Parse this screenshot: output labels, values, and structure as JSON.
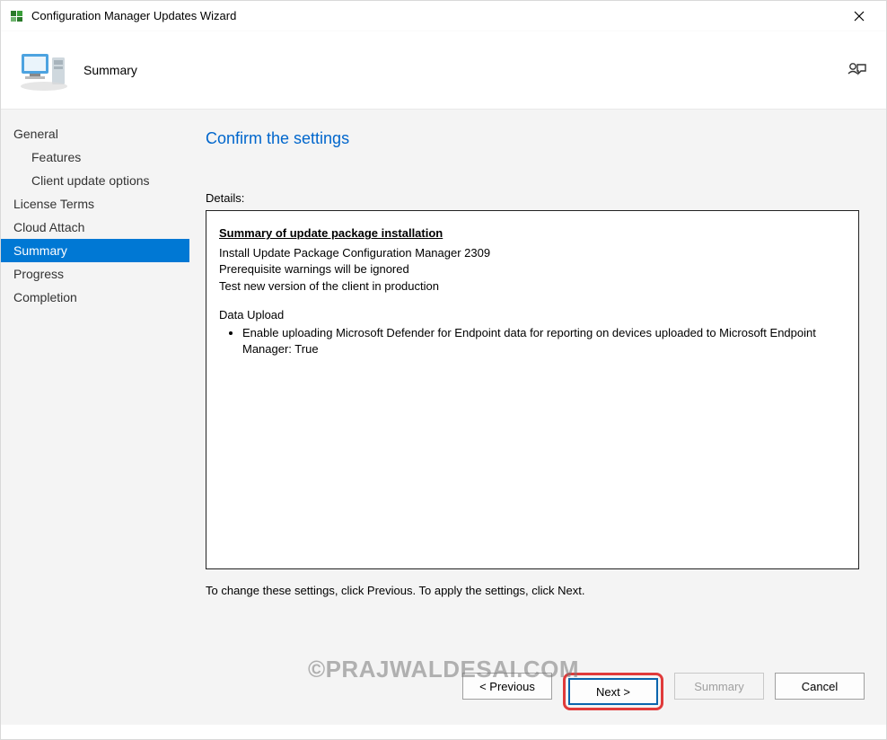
{
  "window": {
    "title": "Configuration Manager Updates Wizard"
  },
  "header": {
    "title": "Summary"
  },
  "sidebar": {
    "items": [
      {
        "label": "General",
        "sub": false,
        "selected": false
      },
      {
        "label": "Features",
        "sub": true,
        "selected": false
      },
      {
        "label": "Client update options",
        "sub": true,
        "selected": false
      },
      {
        "label": "License Terms",
        "sub": false,
        "selected": false
      },
      {
        "label": "Cloud Attach",
        "sub": false,
        "selected": false
      },
      {
        "label": "Summary",
        "sub": false,
        "selected": true
      },
      {
        "label": "Progress",
        "sub": false,
        "selected": false
      },
      {
        "label": "Completion",
        "sub": false,
        "selected": false
      }
    ]
  },
  "content": {
    "heading": "Confirm the settings",
    "details_label": "Details:",
    "summary_title": "Summary of update package installation",
    "lines": [
      "Install Update Package Configuration Manager 2309",
      "Prerequisite warnings will be ignored",
      "Test new version of the client in production"
    ],
    "data_upload_label": "Data Upload",
    "data_upload_bullet": "Enable uploading Microsoft Defender for Endpoint data for reporting on devices uploaded to Microsoft Endpoint Manager: True",
    "hint": "To change these settings, click Previous. To apply the settings, click Next."
  },
  "footer": {
    "previous": "< Previous",
    "next": "Next >",
    "summary": "Summary",
    "cancel": "Cancel"
  },
  "watermark": "©PRAJWALDESAI.COM"
}
